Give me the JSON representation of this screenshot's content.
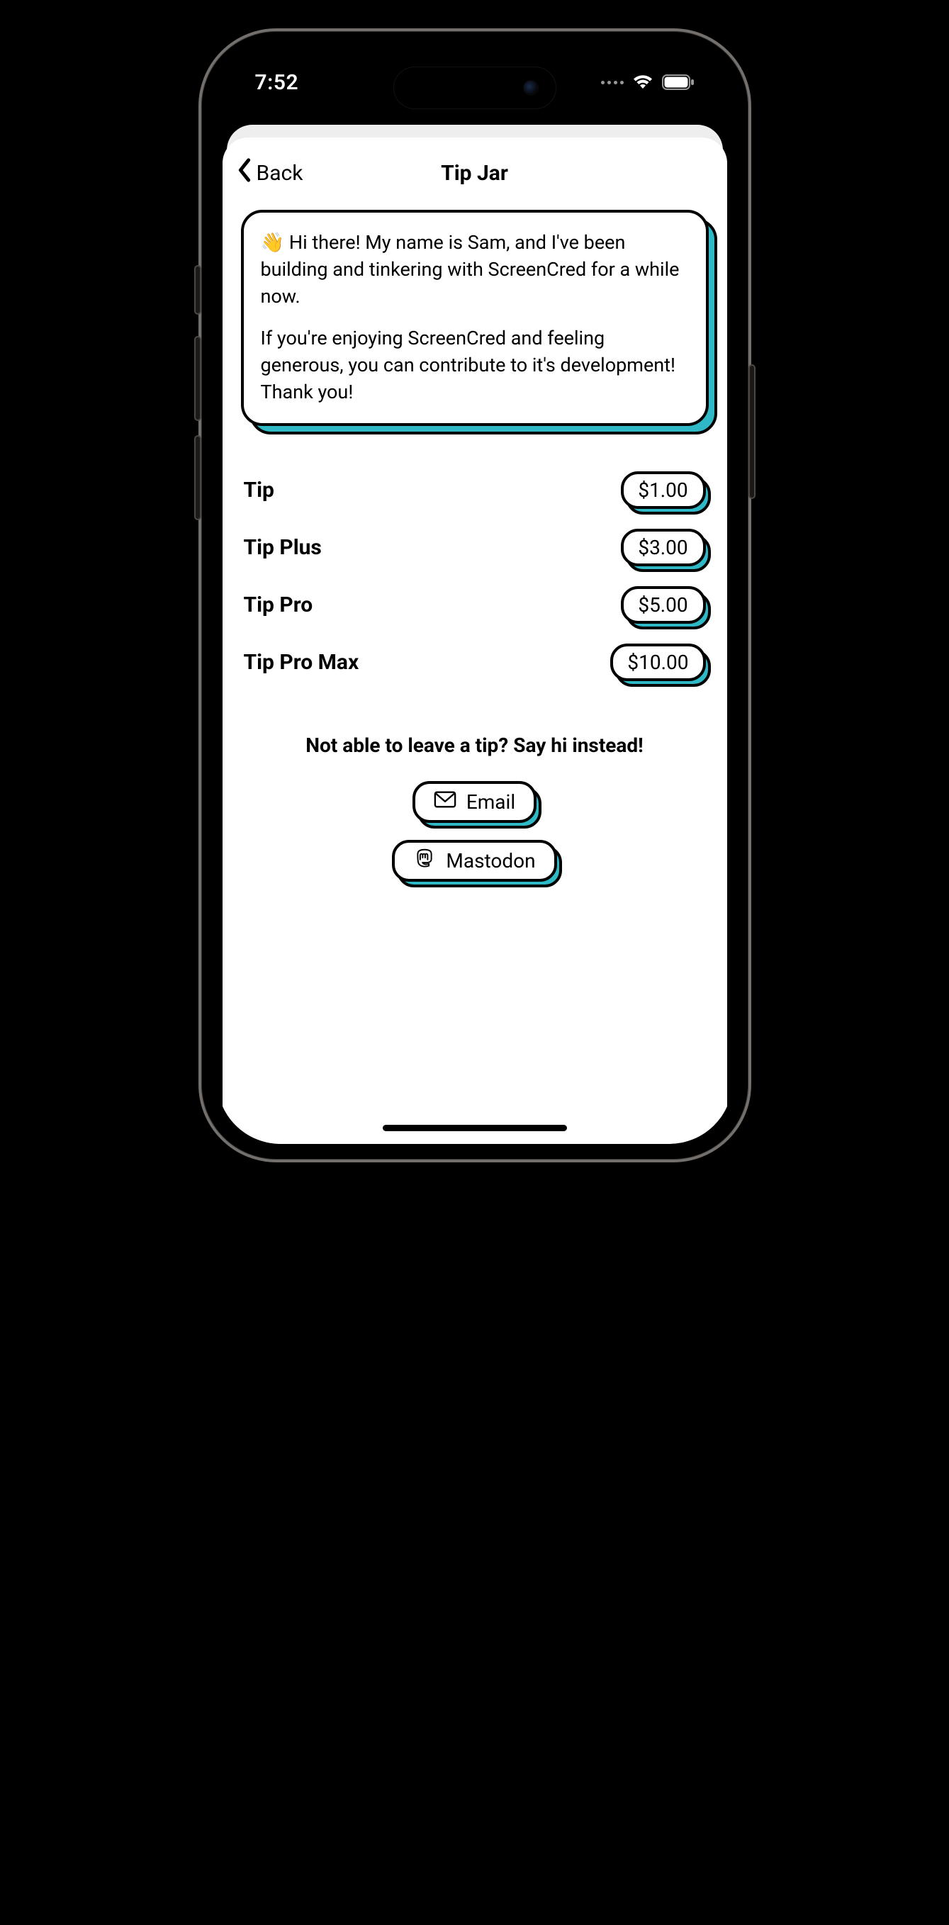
{
  "status": {
    "time": "7:52"
  },
  "nav": {
    "back_label": "Back",
    "title": "Tip Jar"
  },
  "intro": {
    "p1": "👋 Hi there! My name is Sam, and I've been building and tinkering with ScreenCred for a while now.",
    "p2": "If you're enjoying ScreenCred and feeling generous, you can contribute to it's development! Thank you!"
  },
  "tips": [
    {
      "name": "Tip",
      "price": "$1.00"
    },
    {
      "name": "Tip Plus",
      "price": "$3.00"
    },
    {
      "name": "Tip Pro",
      "price": "$5.00"
    },
    {
      "name": "Tip Pro Max",
      "price": "$10.00"
    }
  ],
  "contact": {
    "heading": "Not able to leave a tip? Say hi instead!",
    "email_label": "Email",
    "mastodon_label": "Mastodon"
  },
  "colors": {
    "accent": "#2fb8c5"
  }
}
